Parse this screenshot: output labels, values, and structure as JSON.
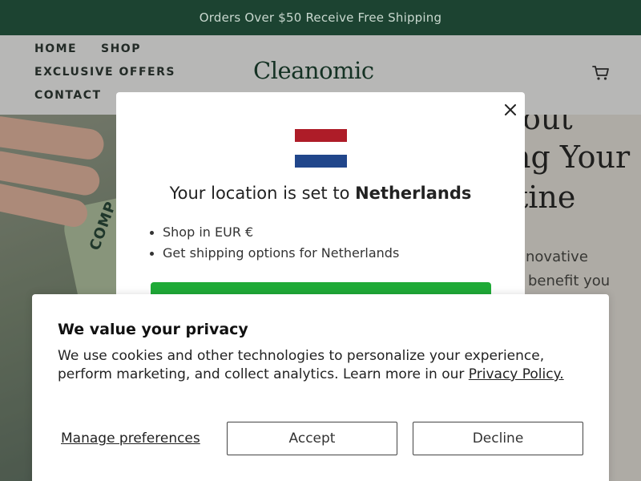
{
  "announcement": "Orders Over $50 Receive Free Shipping",
  "nav": {
    "home": "HOME",
    "shop": "SHOP",
    "exclusive_offers": "EXCLUSIVE OFFERS",
    "contact": "CONTACT"
  },
  "brand": "Cleanomic",
  "icons": {
    "cart": "cart-icon",
    "close": "close-icon"
  },
  "hero": {
    "heading_lines": [
      "out",
      "ng Your",
      "tine"
    ],
    "body_lines": [
      "novative",
      "benefit you"
    ],
    "bag_text": "COMP"
  },
  "location_modal": {
    "title_prefix": "Your location is set to",
    "country": "Netherlands",
    "bullets": [
      "Shop in EUR €",
      "Get shipping options for Netherlands"
    ],
    "flag_colors": [
      "#ae1c28",
      "#ffffff",
      "#21468b"
    ],
    "button_color": "#1faa37"
  },
  "cookie": {
    "title": "We value your privacy",
    "text": "We use cookies and other technologies to personalize your experience, perform marketing, and collect analytics. Learn more in our",
    "link": "Privacy Policy.",
    "manage": "Manage preferences",
    "accept": "Accept",
    "decline": "Decline"
  },
  "colors": {
    "announcement_bg": "#1c4331",
    "brand": "#1c4331"
  }
}
